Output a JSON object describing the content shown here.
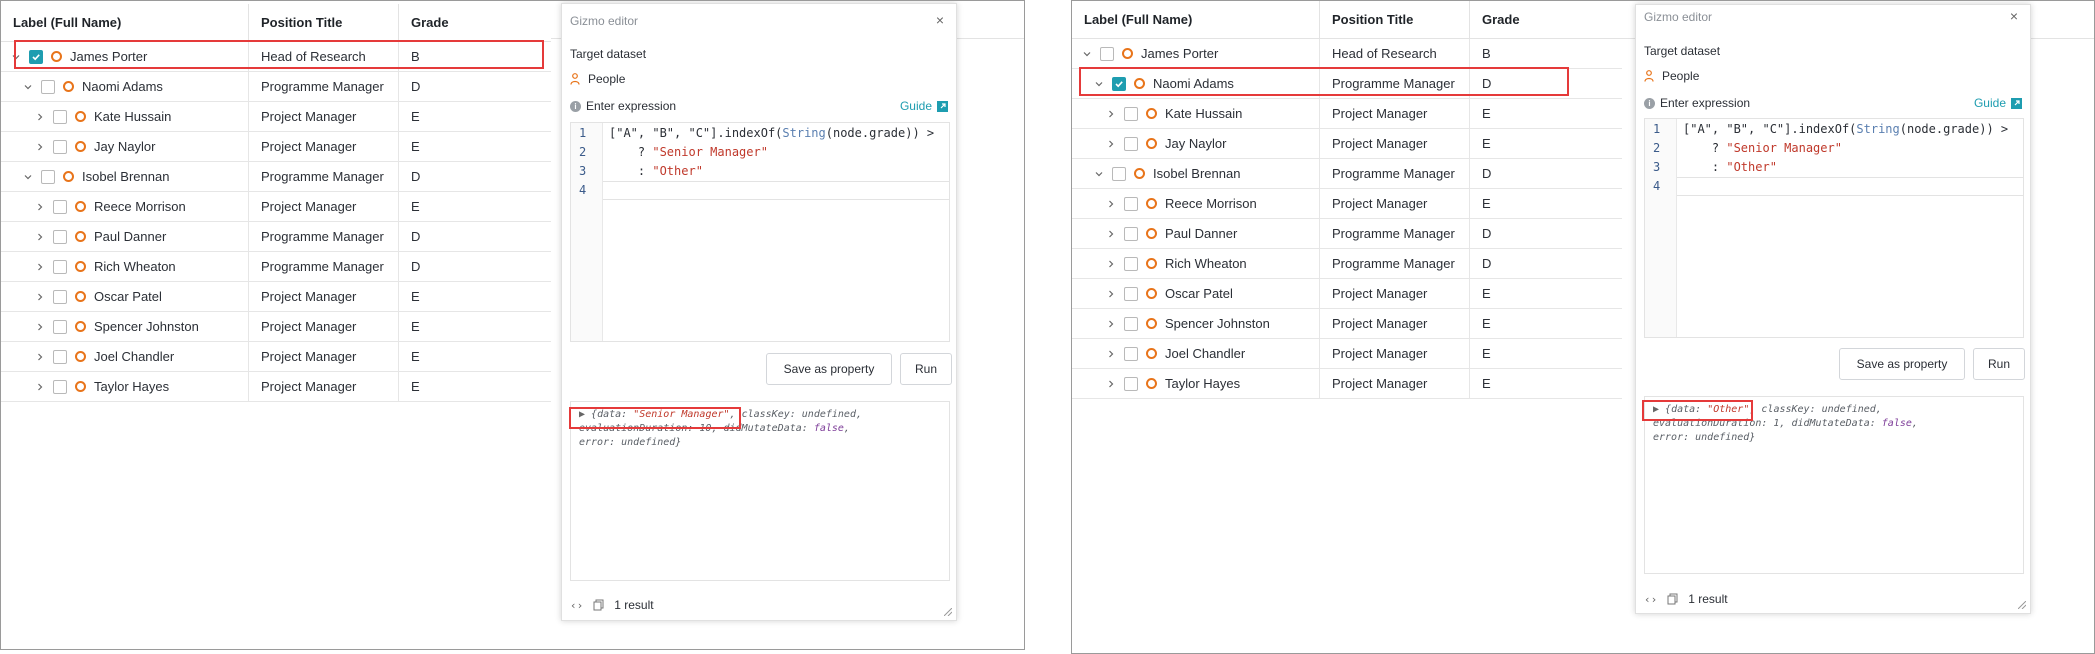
{
  "left": {
    "columns": [
      "Label (Full Name)",
      "Position Title",
      "Grade"
    ],
    "rows": [
      {
        "name": "James Porter",
        "position": "Head of Research",
        "grade": "B",
        "checked": true
      },
      {
        "name": "Naomi Adams",
        "position": "Programme Manager",
        "grade": "D",
        "checked": false
      },
      {
        "name": "Kate Hussain",
        "position": "Project Manager",
        "grade": "E",
        "checked": false
      },
      {
        "name": "Jay Naylor",
        "position": "Project Manager",
        "grade": "E",
        "checked": false
      },
      {
        "name": "Isobel Brennan",
        "position": "Programme Manager",
        "grade": "D",
        "checked": false
      },
      {
        "name": "Reece Morrison",
        "position": "Project Manager",
        "grade": "E",
        "checked": false
      },
      {
        "name": "Paul Danner",
        "position": "Programme Manager",
        "grade": "D",
        "checked": false
      },
      {
        "name": "Rich Wheaton",
        "position": "Programme Manager",
        "grade": "D",
        "checked": false
      },
      {
        "name": "Oscar Patel",
        "position": "Project Manager",
        "grade": "E",
        "checked": false
      },
      {
        "name": "Spencer Johnston",
        "position": "Project Manager",
        "grade": "E",
        "checked": false
      },
      {
        "name": "Joel Chandler",
        "position": "Project Manager",
        "grade": "E",
        "checked": false
      },
      {
        "name": "Taylor Hayes",
        "position": "Project Manager",
        "grade": "E",
        "checked": false
      }
    ],
    "editor": {
      "title": "Gizmo editor",
      "close": "×",
      "target_label": "Target dataset",
      "dataset": "People",
      "expr_label": "Enter expression",
      "guide": "Guide",
      "code": {
        "l1_a": "[\"A\", \"B\", \"C\"].indexOf(",
        "l1_fn": "String",
        "l1_b": "(node.grade)) >",
        "l2_a": "    ? ",
        "l2_s": "\"Senior Manager\"",
        "l3_a": "    : ",
        "l3_s": "\"Other\""
      },
      "save_label": "Save as property",
      "run_label": "Run",
      "output": {
        "data_key": "{data: ",
        "data_val": "\"Senior Manager\"",
        "rest1": ", classKey: undefined,",
        "rest2": "evaluationDuration: 10, didMutateData: ",
        "bool": "false",
        "rest2_end": ",",
        "rest3": "error: undefined}"
      },
      "result_count": "1 result"
    }
  },
  "right": {
    "columns": [
      "Label (Full Name)",
      "Position Title",
      "Grade"
    ],
    "rows": [
      {
        "name": "James Porter",
        "position": "Head of Research",
        "grade": "B",
        "checked": false
      },
      {
        "name": "Naomi Adams",
        "position": "Programme Manager",
        "grade": "D",
        "checked": true
      },
      {
        "name": "Kate Hussain",
        "position": "Project Manager",
        "grade": "E",
        "checked": false
      },
      {
        "name": "Jay Naylor",
        "position": "Project Manager",
        "grade": "E",
        "checked": false
      },
      {
        "name": "Isobel Brennan",
        "position": "Programme Manager",
        "grade": "D",
        "checked": false
      },
      {
        "name": "Reece Morrison",
        "position": "Project Manager",
        "grade": "E",
        "checked": false
      },
      {
        "name": "Paul Danner",
        "position": "Programme Manager",
        "grade": "D",
        "checked": false
      },
      {
        "name": "Rich Wheaton",
        "position": "Programme Manager",
        "grade": "D",
        "checked": false
      },
      {
        "name": "Oscar Patel",
        "position": "Project Manager",
        "grade": "E",
        "checked": false
      },
      {
        "name": "Spencer Johnston",
        "position": "Project Manager",
        "grade": "E",
        "checked": false
      },
      {
        "name": "Joel Chandler",
        "position": "Project Manager",
        "grade": "E",
        "checked": false
      },
      {
        "name": "Taylor Hayes",
        "position": "Project Manager",
        "grade": "E",
        "checked": false
      }
    ],
    "editor": {
      "title": "Gizmo editor",
      "close": "×",
      "target_label": "Target dataset",
      "dataset": "People",
      "expr_label": "Enter expression",
      "guide": "Guide",
      "code": {
        "l1_a": "[\"A\", \"B\", \"C\"].indexOf(",
        "l1_fn": "String",
        "l1_b": "(node.grade)) >",
        "l2_a": "    ? ",
        "l2_s": "\"Senior Manager\"",
        "l3_a": "    : ",
        "l3_s": "\"Other\""
      },
      "save_label": "Save as property",
      "run_label": "Run",
      "output": {
        "data_key": "{data: ",
        "data_val": "\"Other\"",
        "rest1": ", classKey: undefined,",
        "rest2": "evaluationDuration: 1, didMutateData: ",
        "bool": "false",
        "rest2_end": ",",
        "rest3": "error: undefined}"
      },
      "result_count": "1 result"
    }
  },
  "colors": {
    "accent": "#1e9db0",
    "node": "#e8741a",
    "highlight": "#e53a3a"
  },
  "icons": [
    "chevron-down-icon",
    "chevron-right-icon",
    "checkbox-icon",
    "node-ring-icon",
    "person-icon",
    "info-icon",
    "external-link-icon",
    "close-icon",
    "code-braces-icon",
    "copy-icon",
    "resize-handle-icon"
  ]
}
